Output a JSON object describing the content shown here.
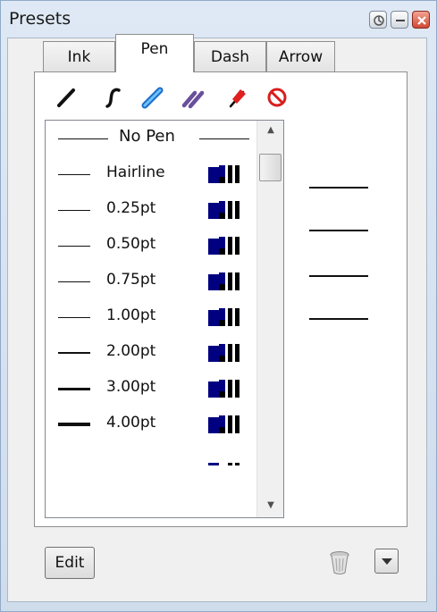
{
  "window": {
    "title": "Presets",
    "title_buttons": [
      "pin-icon",
      "minimize-icon",
      "close-icon"
    ]
  },
  "tabs": [
    {
      "label": "Ink",
      "active": false
    },
    {
      "label": "Pen",
      "active": true
    },
    {
      "label": "Dash",
      "active": false
    },
    {
      "label": "Arrow",
      "active": false
    }
  ],
  "toolbar_icons": [
    "pen-straight-icon",
    "pen-curve-icon",
    "highlighter-icon",
    "double-pen-icon",
    "marker-red-icon",
    "no-entry-icon"
  ],
  "pen_list": {
    "header": "No Pen",
    "items": [
      {
        "label": "Hairline",
        "weight": 1
      },
      {
        "label": "0.25pt",
        "weight": 1
      },
      {
        "label": "0.50pt",
        "weight": 1
      },
      {
        "label": "0.75pt",
        "weight": 1
      },
      {
        "label": "1.00pt",
        "weight": 1
      },
      {
        "label": "2.00pt",
        "weight": 2
      },
      {
        "label": "3.00pt",
        "weight": 3
      },
      {
        "label": "4.00pt",
        "weight": 4
      }
    ]
  },
  "preview_lines": 4,
  "buttons": {
    "edit": "Edit"
  },
  "colors": {
    "pen_chip": "#000080",
    "accent_blue": "#2f8fe0",
    "close_red": "#cf4a35"
  }
}
